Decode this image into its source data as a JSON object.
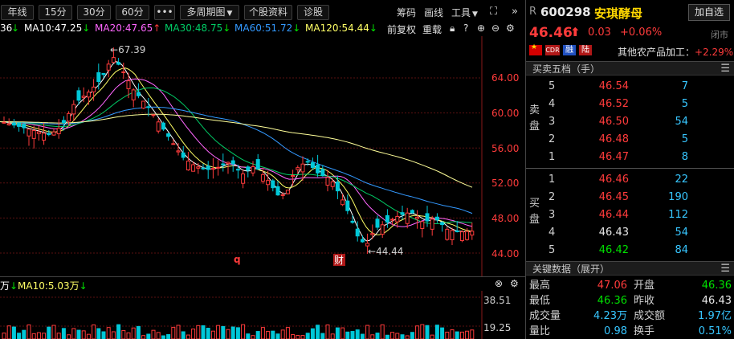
{
  "toolbar": {
    "buttons": [
      "年线",
      "15分",
      "30分",
      "60分",
      "•••",
      "多周期图",
      "个股资料",
      "诊股"
    ],
    "right_items": [
      "筹码",
      "画线",
      "工具"
    ],
    "expand_icon": "expand-icon",
    "more_icon": "double-chevron-right-icon"
  },
  "ma_legend": {
    "partial": "36",
    "items": [
      {
        "label": "MA10:47.25",
        "dir": "down",
        "color": "#ffffff"
      },
      {
        "label": "MA20:47.65",
        "dir": "up",
        "color": "#ff66ff"
      },
      {
        "label": "MA30:48.75",
        "dir": "down",
        "color": "#00cc66"
      },
      {
        "label": "MA60:51.72",
        "dir": "down",
        "color": "#3399ff"
      },
      {
        "label": "MA120:54.44",
        "dir": "down",
        "color": "#ffff66"
      }
    ],
    "adjust_label": "前复权",
    "overlay_label": "重载"
  },
  "chart": {
    "y_ticks": [
      "64.00",
      "60.00",
      "56.00",
      "52.00",
      "48.00",
      "44.00"
    ],
    "high_label": "67.39",
    "low_label": "44.44",
    "q_marker": "q",
    "cai_marker": "财"
  },
  "volume": {
    "legend_partial": "万",
    "ma10_label": "MA10:5.03万",
    "y_ticks": [
      "38.51",
      "19.25"
    ]
  },
  "quote": {
    "prefix": "R",
    "code": "600298",
    "name": "安琪酵母",
    "add_fav": "加自选",
    "price": "46.46",
    "change": "0.03",
    "change_pct": "+0.06%",
    "status": "闭市",
    "badges": [
      "CDR",
      "融",
      "陆"
    ],
    "sector": "其他农产品加工：",
    "sector_pct": "+2.29%"
  },
  "orderbook": {
    "title": "买卖五档（手）",
    "sell_label": "卖盘",
    "buy_label": "买盘",
    "sell": [
      {
        "level": "5",
        "price": "46.54",
        "qty": "7"
      },
      {
        "level": "4",
        "price": "46.52",
        "qty": "5"
      },
      {
        "level": "3",
        "price": "46.50",
        "qty": "54"
      },
      {
        "level": "2",
        "price": "46.48",
        "qty": "5"
      },
      {
        "level": "1",
        "price": "46.47",
        "qty": "8"
      }
    ],
    "buy": [
      {
        "level": "1",
        "price": "46.46",
        "qty": "22"
      },
      {
        "level": "2",
        "price": "46.45",
        "qty": "190"
      },
      {
        "level": "3",
        "price": "46.44",
        "qty": "112"
      },
      {
        "level": "4",
        "price": "46.43",
        "qty": "54"
      },
      {
        "level": "5",
        "price": "46.42",
        "qty": "84"
      }
    ]
  },
  "key_data": {
    "title": "关键数据（展开）",
    "rows": [
      {
        "l1": "最高",
        "v1": "47.06",
        "l2": "开盘",
        "v2": "46.36"
      },
      {
        "l1": "最低",
        "v1": "46.36",
        "l2": "昨收",
        "v2": "46.43"
      },
      {
        "l1": "成交量",
        "v1": "4.23万",
        "l2": "成交额",
        "v2": "1.97亿"
      },
      {
        "l1": "量比",
        "v1": "0.98",
        "l2": "换手",
        "v2": "0.51%"
      }
    ]
  },
  "colors": {
    "up": "#ff3b3b",
    "down": "#00e000",
    "cyan": "#00c8d8",
    "axis": "#ff3b3b"
  }
}
